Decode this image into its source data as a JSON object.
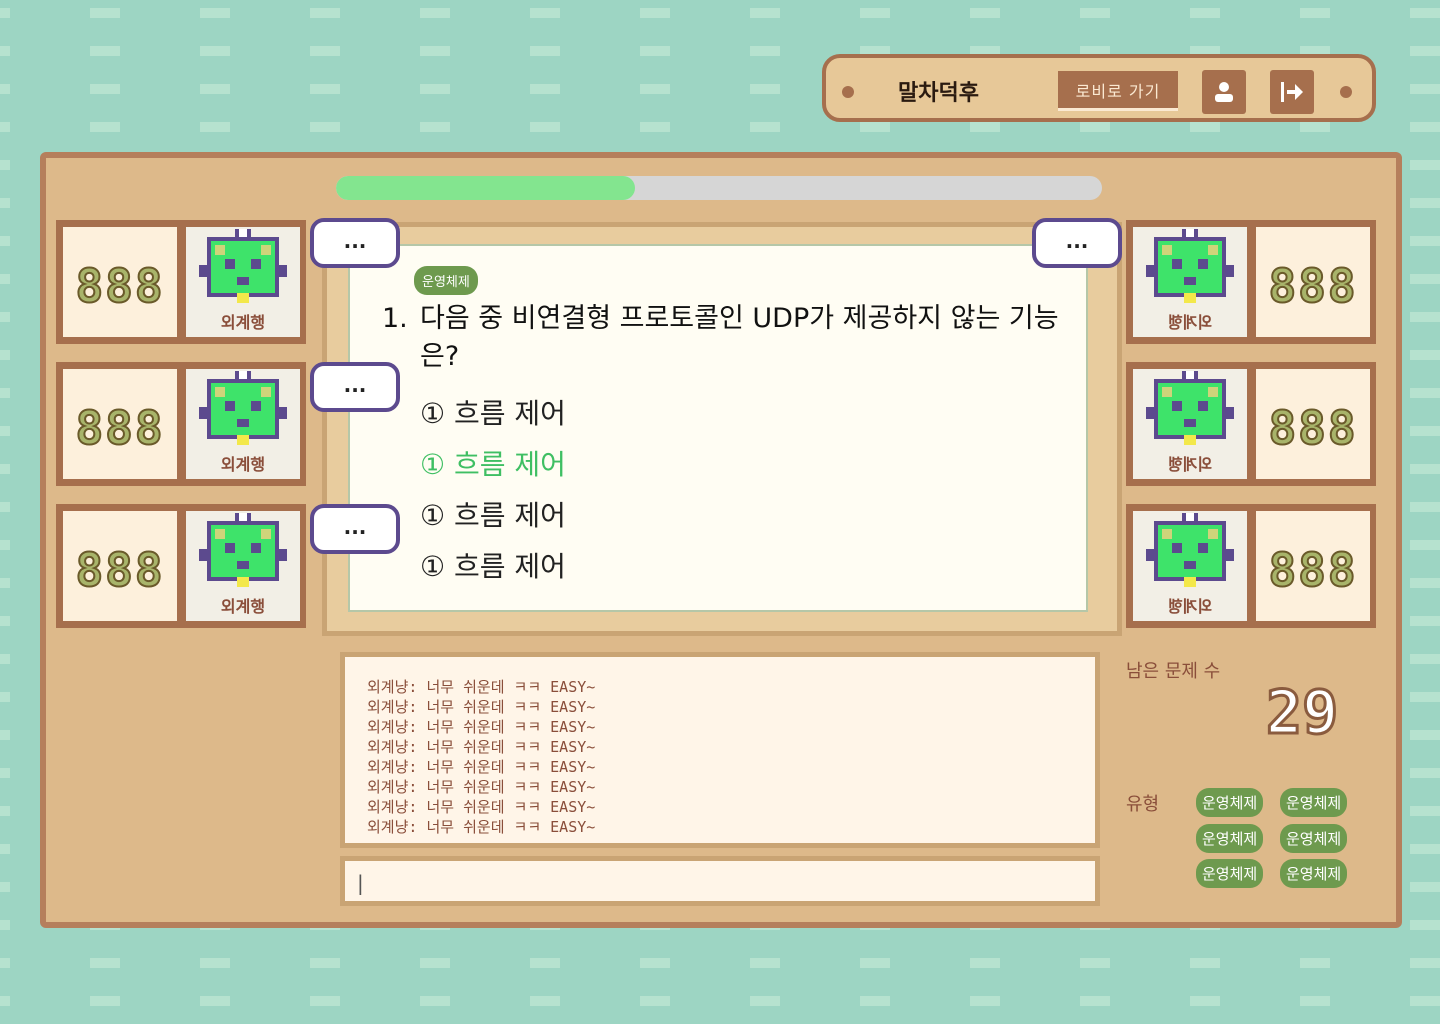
{
  "header": {
    "nickname": "말차덕후",
    "lobby_button": "로비로 가기"
  },
  "progress": {
    "fraction": 0.39
  },
  "question": {
    "category": "운영체제",
    "number": "1.",
    "text": "다음 중 비연결형 프로토콜인 UDP가 제공하지 않는 기능은?",
    "options": [
      "① 흐름 제어",
      "① 흐름 제어",
      "① 흐름 제어",
      "① 흐름 제어"
    ],
    "selected_index": 1
  },
  "players_left": [
    {
      "score": "888",
      "name": "외계행",
      "bubble": "..."
    },
    {
      "score": "888",
      "name": "외계행",
      "bubble": "..."
    },
    {
      "score": "888",
      "name": "외계행",
      "bubble": "..."
    }
  ],
  "players_right": [
    {
      "score": "888",
      "name": "외계행",
      "bubble": "..."
    },
    {
      "score": "888",
      "name": "외계행",
      "bubble": ""
    },
    {
      "score": "888",
      "name": "외계행",
      "bubble": ""
    }
  ],
  "chat": {
    "messages": [
      "외계냥: 너무 쉬운데 ㅋㅋ EASY~",
      "외계냥: 너무 쉬운데 ㅋㅋ EASY~",
      "외계냥: 너무 쉬운데 ㅋㅋ EASY~",
      "외계냥: 너무 쉬운데 ㅋㅋ EASY~",
      "외계냥: 너무 쉬운데 ㅋㅋ EASY~",
      "외계냥: 너무 쉬운데 ㅋㅋ EASY~",
      "외계냥: 너무 쉬운데 ㅋㅋ EASY~",
      "외계냥: 너무 쉬운데 ㅋㅋ EASY~"
    ],
    "input_value": "|"
  },
  "info": {
    "remaining_label": "남은 문제 수",
    "remaining_count": "29",
    "type_label": "유형",
    "types": [
      "운영체제",
      "운영체제",
      "운영체제",
      "운영체제",
      "운영체제",
      "운영체제"
    ]
  },
  "colors": {
    "accent_green": "#83e58f",
    "frame_brown": "#a66f4d",
    "tag_green": "#6e9a4e"
  },
  "icons": {
    "profile": "user-icon",
    "logout": "logout-icon"
  }
}
